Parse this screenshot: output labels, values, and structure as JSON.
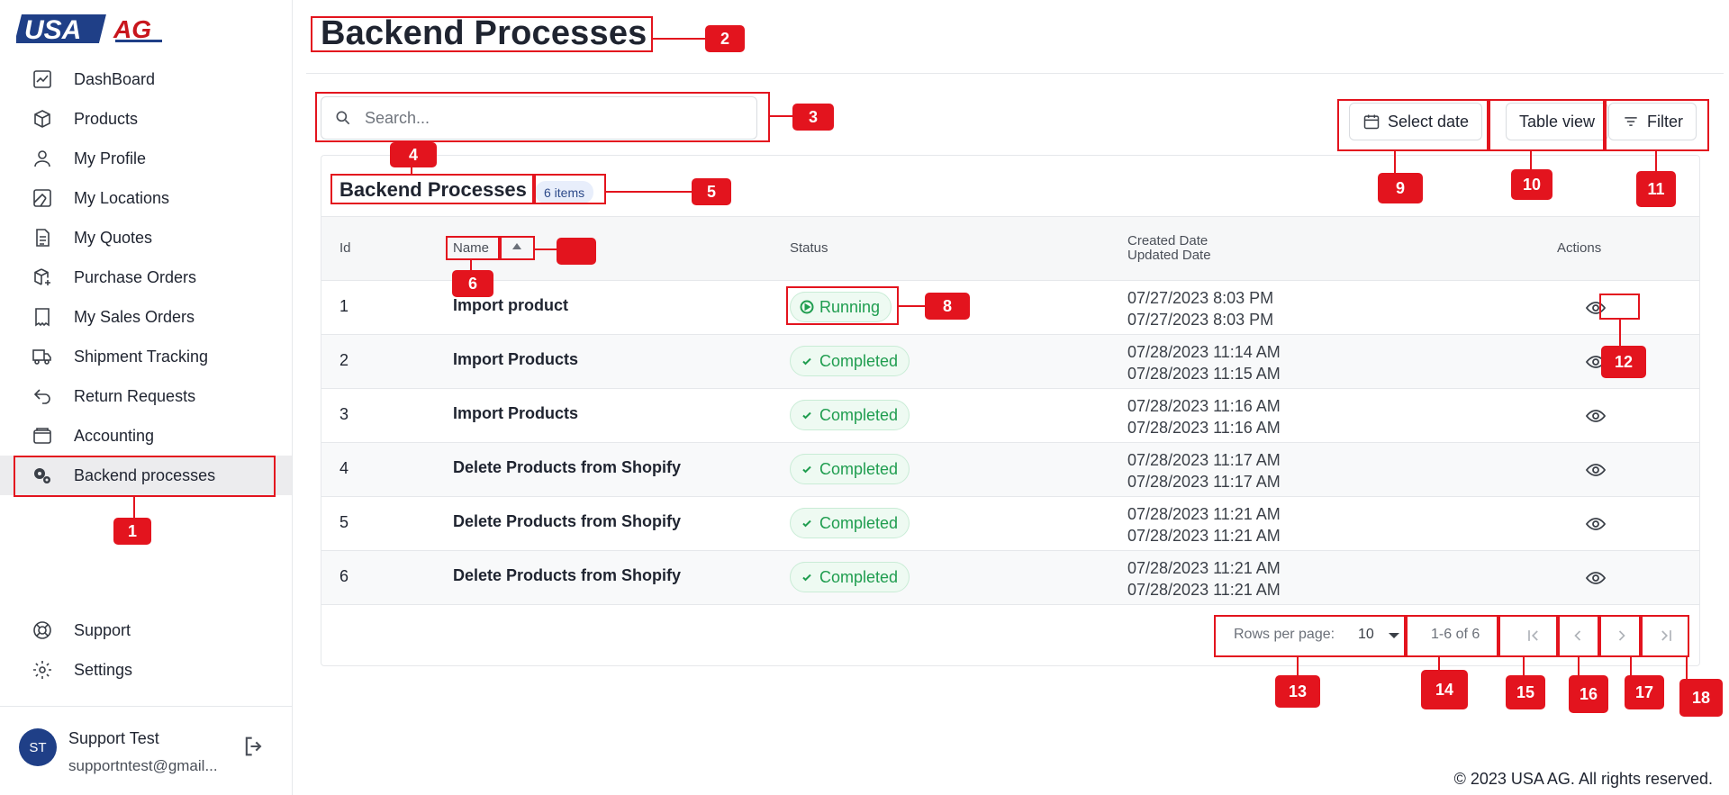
{
  "brand": {
    "logo_text_usa": "USA",
    "logo_text_ag": "AG"
  },
  "sidebar": {
    "items": [
      {
        "label": "DashBoard",
        "icon": "chart-line-icon"
      },
      {
        "label": "Products",
        "icon": "box-icon"
      },
      {
        "label": "My Profile",
        "icon": "user-icon"
      },
      {
        "label": "My Locations",
        "icon": "map-icon"
      },
      {
        "label": "My Quotes",
        "icon": "document-icon"
      },
      {
        "label": "Purchase Orders",
        "icon": "package-plus-icon"
      },
      {
        "label": "My Sales Orders",
        "icon": "receipt-icon"
      },
      {
        "label": "Shipment Tracking",
        "icon": "truck-icon"
      },
      {
        "label": "Return Requests",
        "icon": "return-arrow-icon"
      },
      {
        "label": "Accounting",
        "icon": "wallet-icon"
      },
      {
        "label": "Backend processes",
        "icon": "gears-icon",
        "active": true
      }
    ],
    "bottom_items": [
      {
        "label": "Support",
        "icon": "lifebuoy-icon"
      },
      {
        "label": "Settings",
        "icon": "gear-icon"
      }
    ],
    "user": {
      "initials": "ST",
      "name": "Support Test",
      "email": "supportntest@gmail..."
    }
  },
  "page": {
    "title": "Backend Processes"
  },
  "search": {
    "placeholder": "Search..."
  },
  "toolbar": {
    "select_date": "Select date",
    "table_view": "Table view",
    "filter": "Filter"
  },
  "table": {
    "title": "Backend Processes",
    "count_badge": "6 items",
    "headers": {
      "id": "Id",
      "name": "Name",
      "status": "Status",
      "created": "Created Date",
      "updated": "Updated Date",
      "actions": "Actions"
    },
    "rows": [
      {
        "id": "1",
        "name": "Import product",
        "status": "Running",
        "created": "07/27/2023 8:03 PM",
        "updated": "07/27/2023 8:03 PM"
      },
      {
        "id": "2",
        "name": "Import Products",
        "status": "Completed",
        "created": "07/28/2023 11:14 AM",
        "updated": "07/28/2023 11:15 AM"
      },
      {
        "id": "3",
        "name": "Import Products",
        "status": "Completed",
        "created": "07/28/2023 11:16 AM",
        "updated": "07/28/2023 11:16 AM"
      },
      {
        "id": "4",
        "name": "Delete Products from Shopify",
        "status": "Completed",
        "created": "07/28/2023 11:17 AM",
        "updated": "07/28/2023 11:17 AM"
      },
      {
        "id": "5",
        "name": "Delete Products from Shopify",
        "status": "Completed",
        "created": "07/28/2023 11:21 AM",
        "updated": "07/28/2023 11:21 AM"
      },
      {
        "id": "6",
        "name": "Delete Products from Shopify",
        "status": "Completed",
        "created": "07/28/2023 11:21 AM",
        "updated": "07/28/2023 11:21 AM"
      }
    ],
    "pagination": {
      "rows_label": "Rows per page:",
      "rows_value": "10",
      "range": "1-6 of 6"
    }
  },
  "footer": {
    "text": "© 2023 USA AG. All rights reserved."
  },
  "annotations": [
    "1",
    "2",
    "3",
    "4",
    "5",
    "6",
    "8",
    "9",
    "10",
    "11",
    "12",
    "13",
    "14",
    "15",
    "16",
    "17",
    "18"
  ],
  "colors": {
    "accent_red": "#e3141e",
    "brand_blue": "#1f3f87",
    "status_green": "#1f9d4f"
  }
}
